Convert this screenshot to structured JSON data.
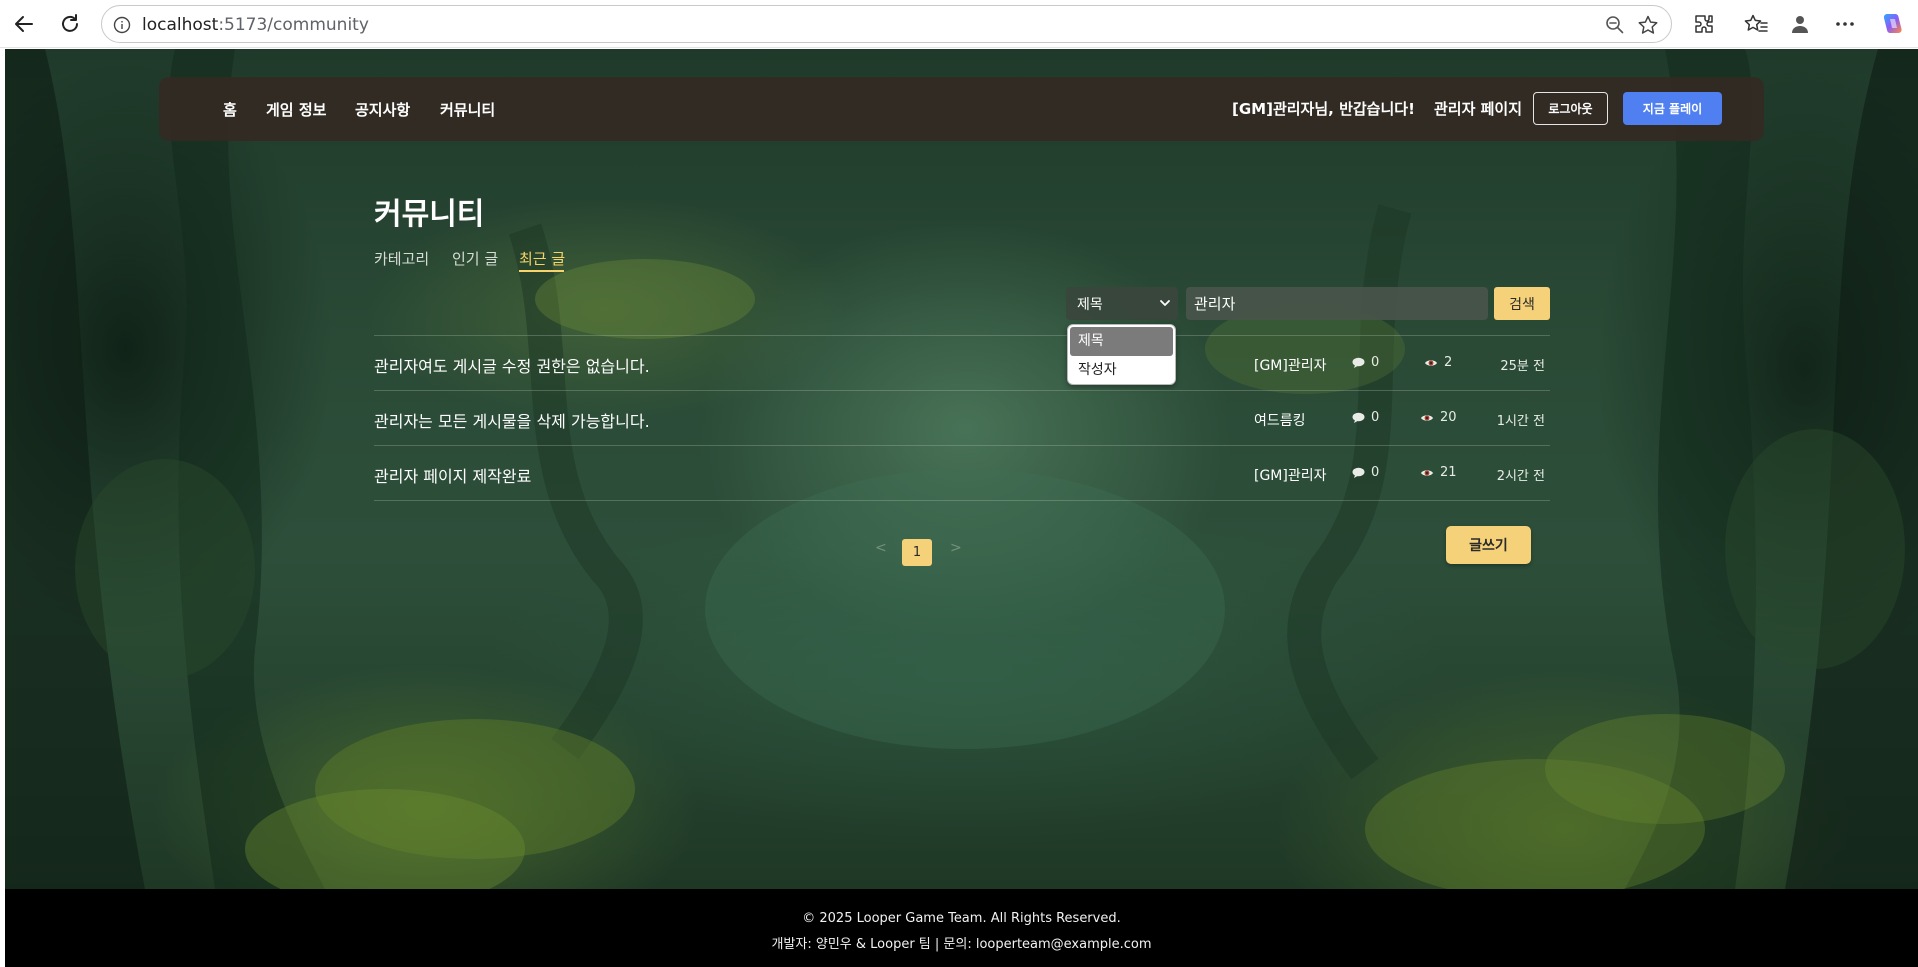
{
  "browser": {
    "url_host": "localhost",
    "url_path": ":5173/community"
  },
  "nav": {
    "links": [
      "홈",
      "게임 정보",
      "공지사항",
      "커뮤니티"
    ],
    "welcome": "[GM]관리자님, 반갑습니다!",
    "admin_page": "관리자 페이지",
    "logout": "로그아웃",
    "play_now": "지금 플레이",
    "play_color": "#4f7ff0"
  },
  "community": {
    "title": "커뮤니티",
    "tabs": [
      "카테고리",
      "인기 글",
      "최근 글"
    ],
    "active_tab": "최근 글",
    "accent_color": "#f7d46a"
  },
  "search": {
    "field_selected": "제목",
    "field_options": [
      "제목",
      "작성자"
    ],
    "query": "관리자",
    "button": "검색"
  },
  "posts": [
    {
      "title": "관리자여도 게시글 수정 권한은 없습니다.",
      "author": "[GM]관리자",
      "comments": "0",
      "views": "2",
      "time": "25분 전"
    },
    {
      "title": "관리자는 모든 게시물을 삭제 가능합니다.",
      "author": "여드름킹",
      "comments": "0",
      "views": "20",
      "time": "1시간 전"
    },
    {
      "title": "관리자 페이지 제작완료",
      "author": "[GM]관리자",
      "comments": "0",
      "views": "21",
      "time": "2시간 전"
    }
  ],
  "pagination": {
    "prev": "<",
    "current": "1",
    "next": ">"
  },
  "write_button": "글쓰기",
  "footer": {
    "copyright": "© 2025 Looper Game Team. All Rights Reserved.",
    "contact": "개발자: 양민우 & Looper 팀 | 문의: looperteam@example.com"
  }
}
